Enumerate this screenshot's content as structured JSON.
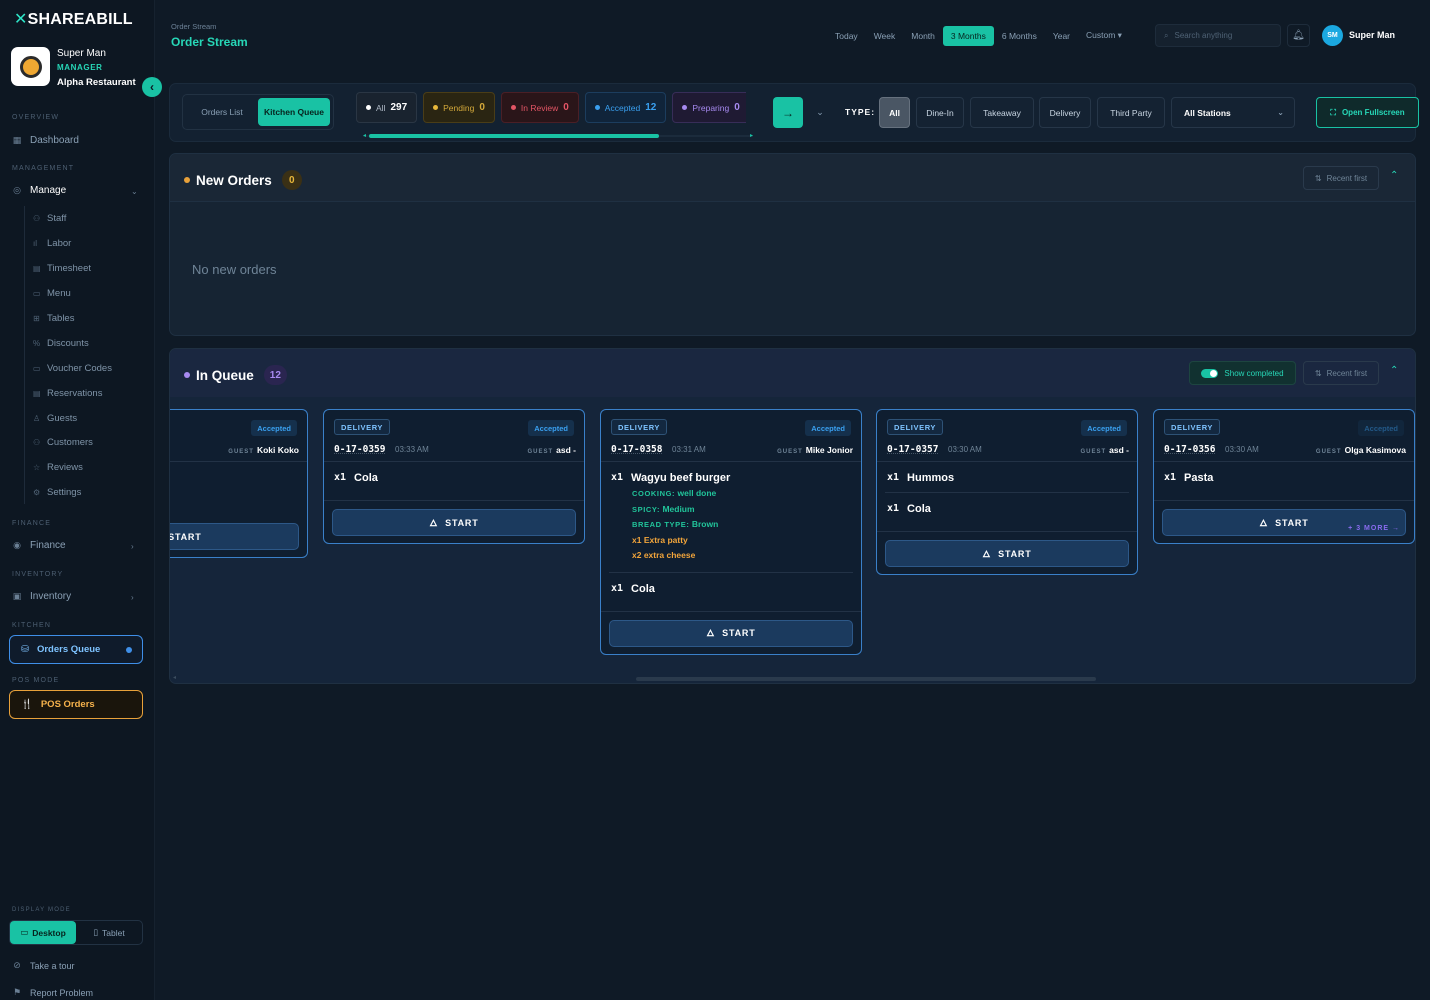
{
  "brand": {
    "name": "SHAREABILL"
  },
  "profile": {
    "name": "Super Man",
    "role": "MANAGER",
    "restaurant": "Alpha Restaurant"
  },
  "sidebar": {
    "sections": {
      "overview": "OVERVIEW",
      "management": "MANAGEMENT",
      "finance": "FINANCE",
      "inventory": "INVENTORY",
      "kitchen": "KITCHEN",
      "pos_mode": "POS MODE",
      "display_mode": "DISPLAY MODE"
    },
    "dashboard": "Dashboard",
    "manage": "Manage",
    "manage_items": [
      "Staff",
      "Labor",
      "Timesheet",
      "Menu",
      "Tables",
      "Discounts",
      "Voucher Codes",
      "Reservations",
      "Guests",
      "Customers",
      "Reviews",
      "Settings"
    ],
    "finance": "Finance",
    "inventory": "Inventory",
    "orders_queue": "Orders Queue",
    "pos_orders": "POS Orders",
    "display": {
      "desktop": "Desktop",
      "tablet": "Tablet"
    },
    "tour": "Take a tour",
    "report": "Report Problem"
  },
  "header": {
    "breadcrumb": "Order Stream",
    "title": "Order Stream",
    "ranges": [
      "Today",
      "Week",
      "Month",
      "3 Months",
      "6 Months",
      "Year",
      "Custom ▾"
    ],
    "active_range": "3 Months",
    "search_placeholder": "Search anything",
    "user_initials": "SM",
    "user_name": "Super Man"
  },
  "toolbar": {
    "view": {
      "list": "Orders List",
      "kitchen": "Kitchen Queue"
    },
    "chips": [
      {
        "label": "All",
        "count": "297"
      },
      {
        "label": "Pending",
        "count": "0"
      },
      {
        "label": "In Review",
        "count": "0"
      },
      {
        "label": "Accepted",
        "count": "12"
      },
      {
        "label": "Preparing",
        "count": "0"
      }
    ],
    "type_label": "TYPE:",
    "types": [
      "All",
      "Dine-In",
      "Takeaway",
      "Delivery",
      "Third Party"
    ],
    "stations": "All Stations",
    "fullscreen": "Open Fullscreen"
  },
  "new_orders": {
    "title": "New Orders",
    "count": "0",
    "sort": "Recent first",
    "empty": "No new orders"
  },
  "in_queue": {
    "title": "In Queue",
    "count": "12",
    "show_completed": "Show completed",
    "sort": "Recent first",
    "start_label": "START",
    "guest_label": "GUEST",
    "more_label": "+ 3 MORE →",
    "cards": [
      {
        "status": "Accepted",
        "guest": "Koki Koko"
      },
      {
        "type": "DELIVERY",
        "status": "Accepted",
        "order_no": "0-17-0359",
        "time": "03:33 AM",
        "guest": "asd -",
        "items": [
          {
            "qty": "x1",
            "name": "Cola"
          }
        ]
      },
      {
        "type": "DELIVERY",
        "status": "Accepted",
        "order_no": "0-17-0358",
        "time": "03:31 AM",
        "guest": "Mike Jonior",
        "items": [
          {
            "qty": "x1",
            "name": "Wagyu beef burger",
            "mods": [
              {
                "k": "COOKING:",
                "v": "well done"
              },
              {
                "k": "SPICY:",
                "v": "Medium"
              },
              {
                "k": "BREAD TYPE:",
                "v": "Brown"
              }
            ],
            "extras": [
              "x1 Extra patty",
              "x2 extra cheese"
            ]
          },
          {
            "qty": "x1",
            "name": "Cola"
          }
        ]
      },
      {
        "type": "DELIVERY",
        "status": "Accepted",
        "order_no": "0-17-0357",
        "time": "03:30 AM",
        "guest": "asd -",
        "items": [
          {
            "qty": "x1",
            "name": "Hummos"
          },
          {
            "qty": "x1",
            "name": "Cola"
          }
        ]
      },
      {
        "type": "DELIVERY",
        "status": "Accepted",
        "order_no": "0-17-0356",
        "time": "03:30 AM",
        "guest": "Olga Kasimova",
        "items": [
          {
            "qty": "x1",
            "name": "Pasta"
          }
        ]
      }
    ]
  },
  "colors": {
    "accent": "#19c2a4",
    "accepted": "#3aa0f0",
    "pending": "#e8b73a",
    "review": "#e35565",
    "preparing": "#a78af0",
    "pos": "#e8a13a"
  }
}
